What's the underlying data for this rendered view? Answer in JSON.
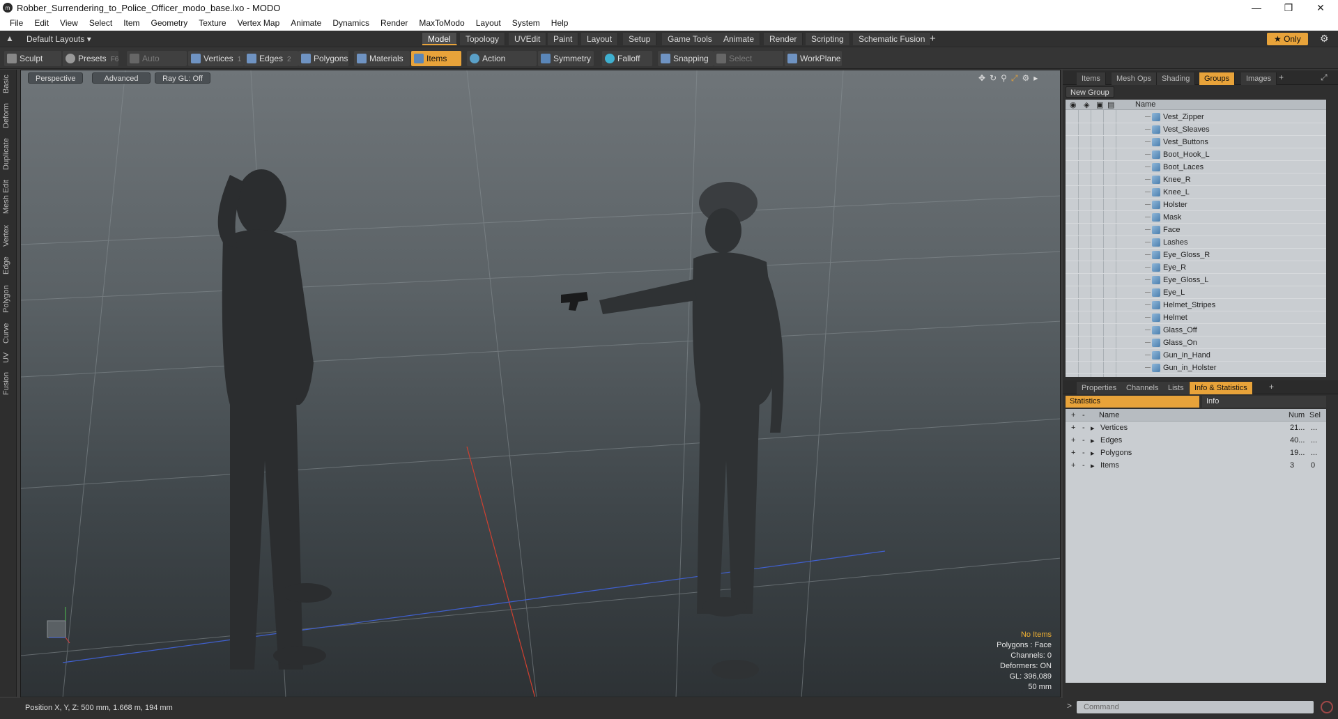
{
  "window": {
    "title": "Robber_Surrendering_to_Police_Officer_modo_base.lxo - MODO"
  },
  "menu": [
    "File",
    "Edit",
    "View",
    "Select",
    "Item",
    "Geometry",
    "Texture",
    "Vertex Map",
    "Animate",
    "Dynamics",
    "Render",
    "MaxToModo",
    "Layout",
    "System",
    "Help"
  ],
  "layout_bar": {
    "preset": "Default Layouts ▾",
    "tabs": [
      "Model",
      "Topology",
      "UVEdit",
      "Paint",
      "Layout",
      "Setup",
      "Game Tools",
      "Animate",
      "Render",
      "Scripting",
      "Schematic Fusion"
    ],
    "active_tab": "Model",
    "only_label": "★ Only"
  },
  "toolbar": {
    "sculpt": "Sculpt",
    "presets": "Presets",
    "presets_key": "F6",
    "auto_select": "Auto Select",
    "vertices": "Vertices",
    "vertices_key": "1",
    "edges": "Edges",
    "edges_key": "2",
    "polygons": "Polygons",
    "materials": "Materials",
    "items": "Items",
    "action_center": "Action Center",
    "symmetry": "Symmetry",
    "falloff": "Falloff",
    "snapping": "Snapping",
    "select_through": "Select Through",
    "workplane": "WorkPlane"
  },
  "left_tabs": [
    "Basic",
    "Deform",
    "Duplicate",
    "Mesh Edit",
    "Vertex",
    "Edge",
    "Polygon",
    "Curve",
    "UV",
    "Fusion"
  ],
  "viewport": {
    "view": "Perspective",
    "mode": "Advanced",
    "raygl": "Ray GL: Off",
    "info": {
      "items": "No Items",
      "polygons": "Polygons : Face",
      "channels": "Channels: 0",
      "deformers": "Deformers: ON",
      "gl": "GL: 396,089",
      "scale": "50 mm"
    }
  },
  "status": {
    "position": "Position X, Y, Z:   500 mm, 1.668 m, 194 mm"
  },
  "top_panel": {
    "tabs": [
      "Items",
      "Mesh Ops",
      "Shading",
      "Groups",
      "Images"
    ],
    "active": "Groups",
    "new_group": "New Group",
    "name_header": "Name",
    "groups": [
      "Vest_Zipper",
      "Vest_Sleaves",
      "Vest_Buttons",
      "Boot_Hook_L",
      "Boot_Laces",
      "Knee_R",
      "Knee_L",
      "Holster",
      "Mask",
      "Face",
      "Lashes",
      "Eye_Gloss_R",
      "Eye_R",
      "Eye_Gloss_L",
      "Eye_L",
      "Helmet_Stripes",
      "Helmet",
      "Glass_Off",
      "Glass_On",
      "Gun_in_Hand",
      "Gun_in_Holster"
    ]
  },
  "bottom_panel": {
    "tabs": [
      "Properties",
      "Channels",
      "Lists",
      "Info & Statistics"
    ],
    "active": "Info & Statistics",
    "sub_tabs": [
      "Statistics",
      "Info"
    ],
    "headers": {
      "name": "Name",
      "num": "Num",
      "sel": "Sel"
    },
    "rows": [
      {
        "name": "Vertices",
        "num": "21...",
        "sel": "..."
      },
      {
        "name": "Edges",
        "num": "40...",
        "sel": "..."
      },
      {
        "name": "Polygons",
        "num": "19...",
        "sel": "..."
      },
      {
        "name": "Items",
        "num": "3",
        "sel": "0"
      }
    ],
    "command_placeholder": "Command"
  }
}
